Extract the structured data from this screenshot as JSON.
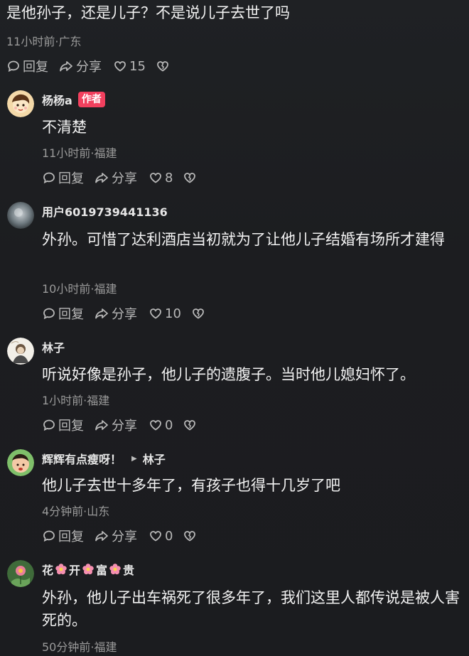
{
  "comments": [
    {
      "text": "是他孙子，还是儿子？不是说儿子去世了吗",
      "meta": "11小时前·广东",
      "actions": {
        "reply": "回复",
        "share": "分享",
        "likes": "15"
      }
    },
    {
      "name": "杨杨a",
      "badge": "作者",
      "text": "不清楚",
      "meta": "11小时前·福建",
      "actions": {
        "reply": "回复",
        "share": "分享",
        "likes": "8"
      }
    },
    {
      "name": "用户6019739441136",
      "text": "外孙。可惜了达利酒店当初就为了让他儿子结婚有场所才建得",
      "meta": "10小时前·福建",
      "actions": {
        "reply": "回复",
        "share": "分享",
        "likes": "10"
      }
    },
    {
      "name": "林子",
      "text": "听说好像是孙子，他儿子的遗腹子。当时他儿媳妇怀了。",
      "meta": "1小时前·福建",
      "actions": {
        "reply": "回复",
        "share": "分享",
        "likes": "0"
      }
    },
    {
      "name": "辉辉有点瘦呀！",
      "reply_to": "林子",
      "text": "他儿子去世十多年了，有孩子也得十几岁了吧",
      "meta": "4分钟前·山东",
      "actions": {
        "reply": "回复",
        "share": "分享",
        "likes": "0"
      }
    },
    {
      "name_parts": [
        "花",
        "开",
        "富",
        "贵"
      ],
      "name_icon": "pink-flower-icon",
      "text": "外孙，他儿子出车祸死了很多年了，我们这里人都传说是被人害死的。",
      "meta": "50分钟前·福建"
    }
  ],
  "colors": {
    "background": "#1c1d20",
    "author_badge": "#f2405e",
    "meta_text": "#9a9a9a",
    "action_text": "#b8b8b8"
  }
}
